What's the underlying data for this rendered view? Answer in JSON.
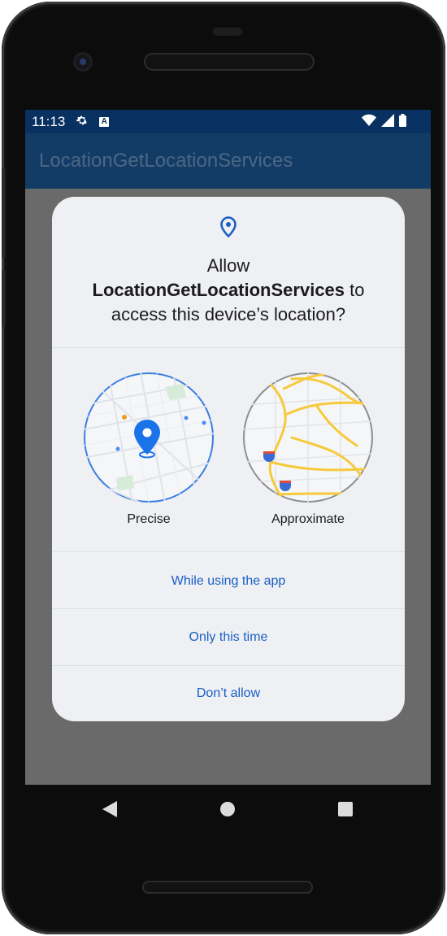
{
  "status_bar": {
    "time": "11:13",
    "gear_icon": "settings-gear",
    "a_icon": "A",
    "wifi_icon": "wifi",
    "signal_icon": "cell-signal",
    "battery_icon": "battery"
  },
  "app_bar": {
    "title": "LocationGetLocationServices"
  },
  "dialog": {
    "icon": "location-pin",
    "title_prefix": "Allow",
    "title_app": "LocationGetLocationServices",
    "title_to": " to",
    "title_suffix": "access this device’s location?",
    "precise_label": "Precise",
    "approximate_label": "Approximate",
    "actions": {
      "while_using": "While using the app",
      "only_this_time": "Only this time",
      "dont_allow": "Don’t allow"
    }
  },
  "colors": {
    "status_bar": "#083060",
    "app_bar": "#123c66",
    "dialog_bg": "#eef0f4",
    "accent": "#1a5fc4",
    "scrim": "#6a6a6a",
    "precise_ring": "#3b7fe0",
    "approximate_ring": "#8f8f8f",
    "road_yellow": "#f6ca3c"
  },
  "nav_bar": {
    "back_icon": "back-triangle",
    "home_icon": "home-circle",
    "recents_icon": "recents-square"
  }
}
